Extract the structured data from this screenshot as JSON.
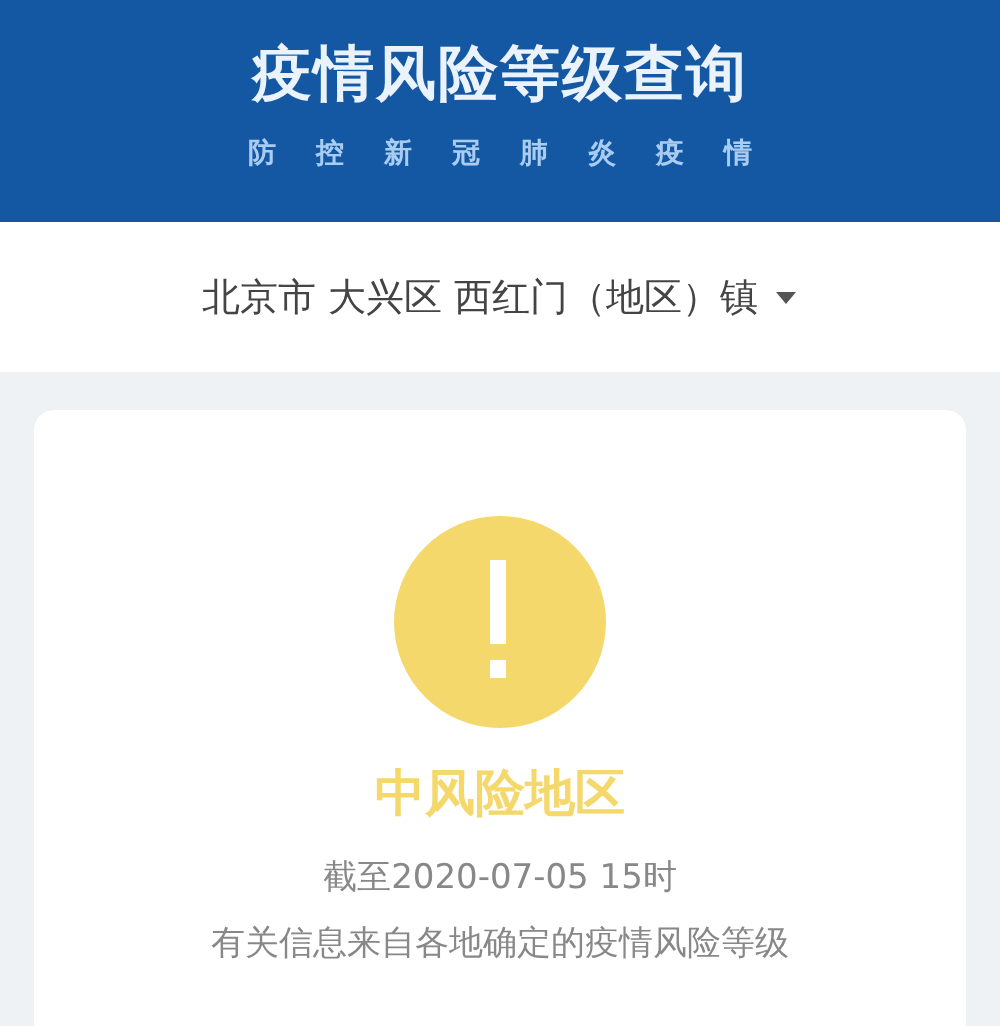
{
  "header": {
    "title": "疫情风险等级查询",
    "subtitle": [
      "防",
      "控",
      "新",
      "冠",
      "肺",
      "炎",
      "疫",
      "情"
    ]
  },
  "location": {
    "value": "北京市 大兴区 西红门（地区）镇"
  },
  "result": {
    "kind": "medium",
    "label": "中风险地区",
    "time": "截至2020-07-05 15时",
    "note": "有关信息来自各地确定的疫情风险等级"
  }
}
